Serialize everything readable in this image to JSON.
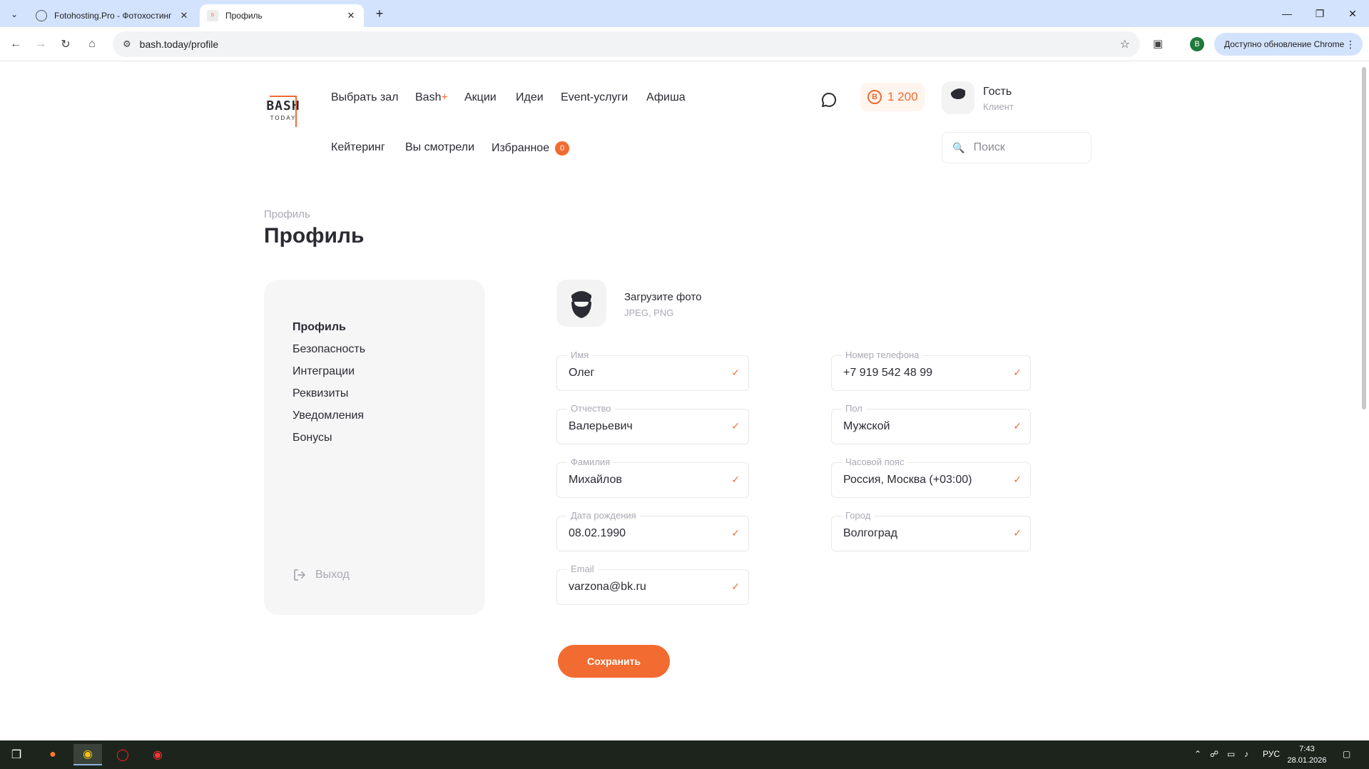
{
  "browser": {
    "tabs": [
      {
        "title": "Fotohosting.Pro - Фотохостинг",
        "active": false
      },
      {
        "title": "Профиль",
        "active": true
      }
    ],
    "url": "bash.today/profile",
    "profile_letter": "B",
    "update_label": "Доступно обновление Chrome"
  },
  "header": {
    "logo_top": "BASH",
    "logo_bottom": "TODAY",
    "nav_row1": [
      "Выбрать зал",
      "Bash",
      "Акции",
      "Идеи",
      "Event-услуги",
      "Афиша"
    ],
    "nav_bash_suffix": "+",
    "nav_row2": [
      "Кейтеринг",
      "Вы смотрели",
      "Избранное"
    ],
    "favorites_count": "0",
    "bonus_symbol": "B",
    "bonus_amount": "1 200",
    "user_name": "Гость",
    "user_role": "Клиент",
    "search_placeholder": "Поиск"
  },
  "breadcrumb": "Профиль",
  "page_title": "Профиль",
  "sidebar": {
    "items": [
      "Профиль",
      "Безопасность",
      "Интеграции",
      "Реквизиты",
      "Уведомления",
      "Бонусы"
    ],
    "active_index": 0,
    "logout": "Выход"
  },
  "photo": {
    "title": "Загрузите фото",
    "hint": "JPEG, PNG"
  },
  "form": {
    "left": [
      {
        "label": "Имя",
        "value": "Олег"
      },
      {
        "label": "Отчество",
        "value": "Валерьевич"
      },
      {
        "label": "Фамилия",
        "value": "Михайлов"
      },
      {
        "label": "Дата рождения",
        "value": "08.02.1990"
      },
      {
        "label": "Email",
        "value": "varzona@bk.ru"
      }
    ],
    "right": [
      {
        "label": "Номер телефона",
        "value": "+7 919 542 48 99"
      },
      {
        "label": "Пол",
        "value": "Мужской"
      },
      {
        "label": "Часовой пояс",
        "value": "Россия, Москва (+03:00)"
      },
      {
        "label": "Город",
        "value": "Волгоград"
      }
    ],
    "save_label": "Сохранить"
  },
  "taskbar": {
    "language": "РУС",
    "time": "7:43",
    "date": "28.01.2026"
  },
  "colors": {
    "accent": "#f26b30",
    "text": "#2b2b33",
    "muted": "#a9a9b3",
    "sidebar_bg": "#f6f6f6"
  }
}
